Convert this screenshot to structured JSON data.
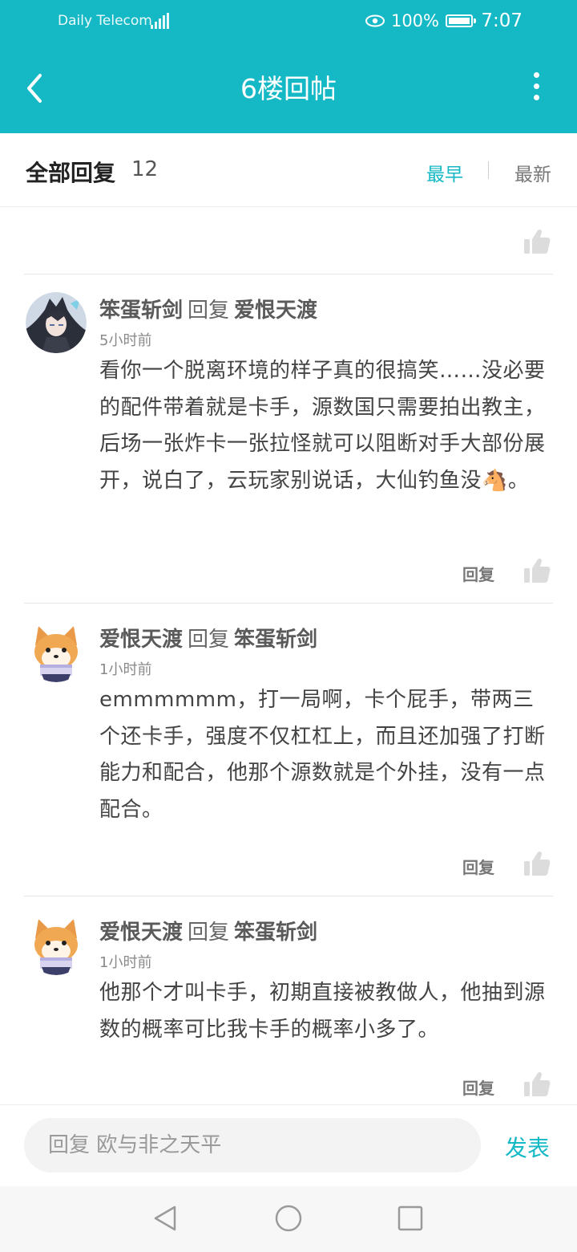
{
  "status_bar": {
    "carrier": "Daily Telecom",
    "battery": "100%",
    "time": "7:07",
    "icons": [
      "signal-icon",
      "eye-comfort-icon",
      "battery-icon"
    ]
  },
  "header": {
    "title": "6楼回帖",
    "back_icon": "back-arrow-icon",
    "more_icon": "more-vertical-icon"
  },
  "reply_header": {
    "title": "全部回复",
    "count": "12",
    "sort_earliest": "最早",
    "sort_latest": "最新",
    "active_sort": "最早"
  },
  "comments": [
    {
      "author": "笨蛋斩剑",
      "reply_word": "回复",
      "target": "爱恨天渡",
      "time": "5小时前",
      "text": "看你一个脱离环境的样子真的很搞笑……没必要的配件带着就是卡手，源数国只需要拍出教主，后场一张炸卡一张拉怪就可以阻断对手大部份展开，说白了，云玩家别说话，大仙钓鱼没🐴。",
      "reply_label": "回复",
      "avatar": "anime-girl-avatar"
    },
    {
      "author": "爱恨天渡",
      "reply_word": "回复",
      "target": "笨蛋斩剑",
      "time": "1小时前",
      "text": "emmmmmm，打一局啊，卡个屁手，带两三个还卡手，强度不仅杠杠上，而且还加强了打断能力和配合，他那个源数就是个外挂，没有一点配合。",
      "reply_label": "回复",
      "avatar": "shiba-dog-avatar"
    },
    {
      "author": "爱恨天渡",
      "reply_word": "回复",
      "target": "笨蛋斩剑",
      "time": "1小时前",
      "text": "他那个才叫卡手，初期直接被教做人，他抽到源数的概率可比我卡手的概率小多了。",
      "reply_label": "回复",
      "avatar": "shiba-dog-avatar"
    }
  ],
  "input_bar": {
    "placeholder": "回复 欧与非之天平",
    "publish": "发表"
  },
  "nav_bar": {
    "icons": [
      "nav-back-icon",
      "nav-home-icon",
      "nav-recents-icon"
    ]
  },
  "colors": {
    "accent": "#15b9c6",
    "text_dark": "#444444",
    "text_muted": "#8a8a8a"
  }
}
